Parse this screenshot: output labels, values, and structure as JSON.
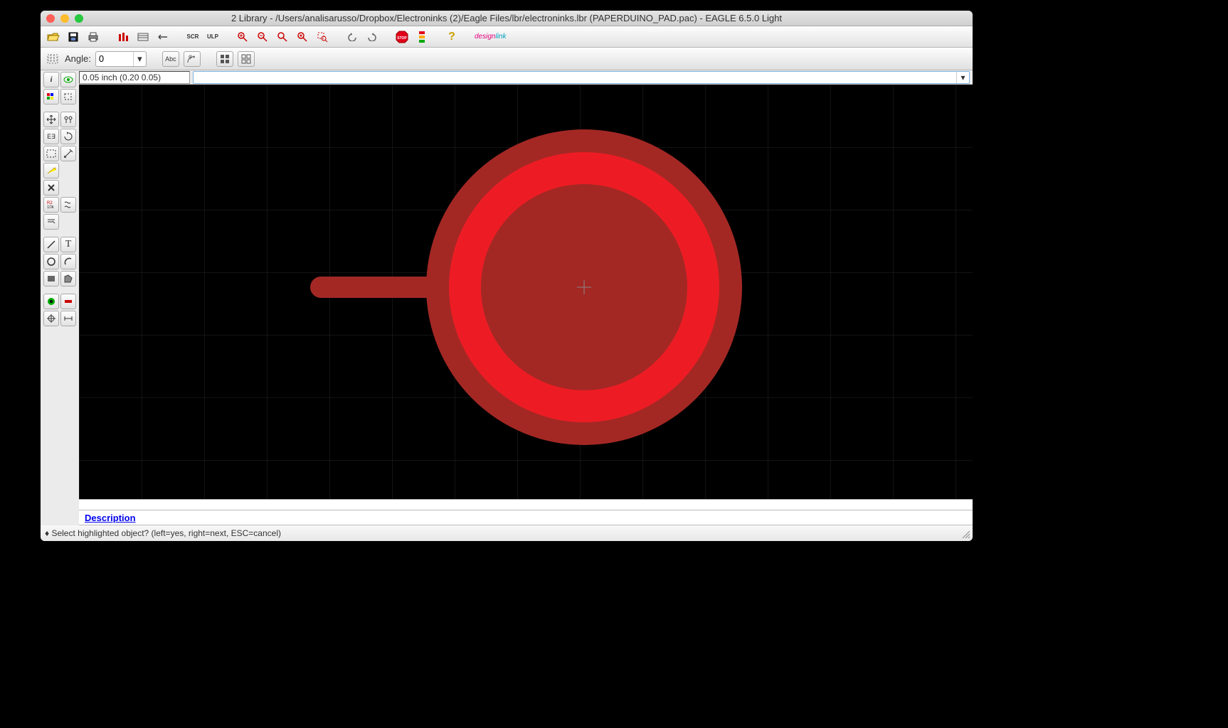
{
  "title": "2 Library - /Users/analisarusso/Dropbox/Electroninks (2)/Eagle Files/lbr/electroninks.lbr (PAPERDUINO_PAD.pac) - EAGLE 6.5.0 Light",
  "coord": "0.05 inch (0.20 0.05)",
  "angle_label": "Angle:",
  "angle_value": "0",
  "description_label": "Description",
  "status": "♦ Select highlighted object? (left=yes, right=next, ESC=cancel)",
  "designlink_a": "design",
  "designlink_b": "link",
  "abc_label": "Abc",
  "stop_label": "STOP",
  "ulp_label": "ULP",
  "scr_label": "SCR",
  "text_label": "T"
}
